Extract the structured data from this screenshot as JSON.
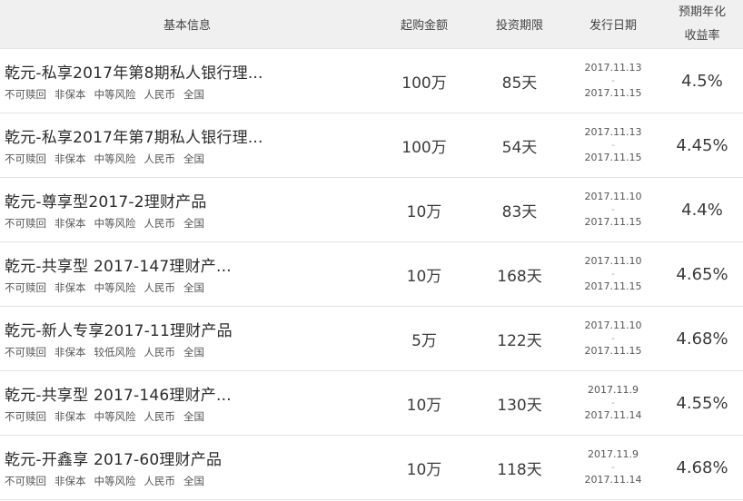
{
  "header": {
    "info": "基本信息",
    "amount": "起购金额",
    "period": "投资期限",
    "date": "发行日期",
    "rate_line1": "预期年化",
    "rate_line2": "收益率"
  },
  "rows": [
    {
      "name": "乾元-私享2017年第8期私人银行理...",
      "tags": [
        "不可赎回",
        "非保本",
        "中等风险",
        "人民币",
        "全国"
      ],
      "amount": "100万",
      "period": "85天",
      "date_start": "2017.11.13",
      "date_sep": "-",
      "date_end": "2017.11.15",
      "rate": "4.5%"
    },
    {
      "name": "乾元-私享2017年第7期私人银行理...",
      "tags": [
        "不可赎回",
        "非保本",
        "中等风险",
        "人民币",
        "全国"
      ],
      "amount": "100万",
      "period": "54天",
      "date_start": "2017.11.13",
      "date_sep": "-",
      "date_end": "2017.11.15",
      "rate": "4.45%"
    },
    {
      "name": "乾元-尊享型2017-2理财产品",
      "tags": [
        "不可赎回",
        "非保本",
        "中等风险",
        "人民币",
        "全国"
      ],
      "amount": "10万",
      "period": "83天",
      "date_start": "2017.11.10",
      "date_sep": "-",
      "date_end": "2017.11.15",
      "rate": "4.4%"
    },
    {
      "name": "乾元-共享型 2017-147理财产...",
      "tags": [
        "不可赎回",
        "非保本",
        "中等风险",
        "人民币",
        "全国"
      ],
      "amount": "10万",
      "period": "168天",
      "date_start": "2017.11.10",
      "date_sep": "-",
      "date_end": "2017.11.15",
      "rate": "4.65%"
    },
    {
      "name": "乾元-新人专享2017-11理财产品",
      "tags": [
        "不可赎回",
        "非保本",
        "较低风险",
        "人民币",
        "全国"
      ],
      "amount": "5万",
      "period": "122天",
      "date_start": "2017.11.10",
      "date_sep": "-",
      "date_end": "2017.11.15",
      "rate": "4.68%"
    },
    {
      "name": "乾元-共享型 2017-146理财产...",
      "tags": [
        "不可赎回",
        "非保本",
        "中等风险",
        "人民币",
        "全国"
      ],
      "amount": "10万",
      "period": "130天",
      "date_start": "2017.11.9",
      "date_sep": "-",
      "date_end": "2017.11.14",
      "rate": "4.55%"
    },
    {
      "name": "乾元-开鑫享 2017-60理财产品",
      "tags": [
        "不可赎回",
        "非保本",
        "中等风险",
        "人民币",
        "全国"
      ],
      "amount": "10万",
      "period": "118天",
      "date_start": "2017.11.9",
      "date_sep": "-",
      "date_end": "2017.11.14",
      "rate": "4.68%"
    }
  ]
}
